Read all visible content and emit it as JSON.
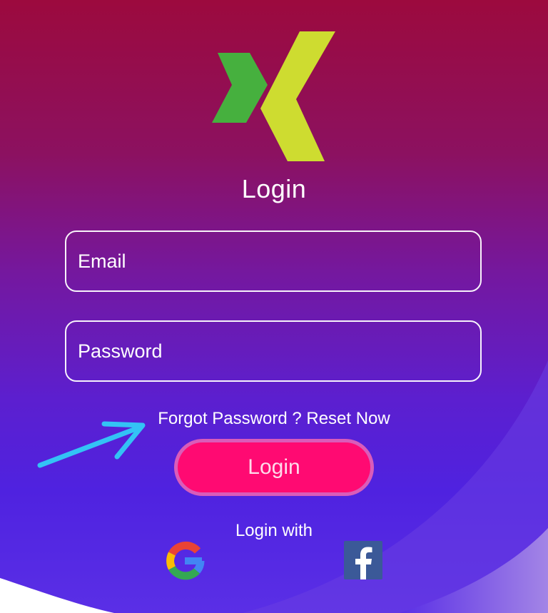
{
  "screen": {
    "title": "Login",
    "email_placeholder": "Email",
    "password_placeholder": "Password",
    "forgot_text": "Forgot Password ? Reset Now",
    "login_button": "Login",
    "login_with": "Login with"
  },
  "icons": {
    "logo": "xing-logo-icon",
    "annotation": "arrow-icon",
    "google": "google-icon",
    "facebook": "facebook-icon"
  },
  "colors": {
    "background_top": "#9c0a3e",
    "background_bottom": "#5a2fe6",
    "logo_green": "#46b03e",
    "logo_lime": "#cedc30",
    "login_button": "#ff0a72",
    "arrow": "#33c3f5",
    "facebook": "#3b5998"
  }
}
